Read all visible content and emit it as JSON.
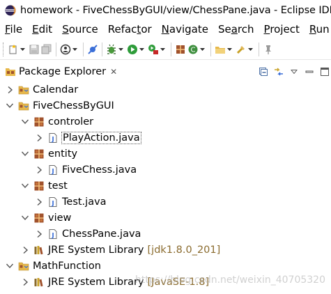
{
  "window": {
    "title": "homework - FiveChessByGUI/view/ChessPane.java - Eclipse IDE"
  },
  "menubar": {
    "items": [
      {
        "mnemonic": "F",
        "rest": "ile"
      },
      {
        "mnemonic": "E",
        "rest": "dit"
      },
      {
        "mnemonic": "S",
        "rest": "ource"
      },
      {
        "pre": "Refac",
        "mnemonic": "t",
        "rest": "or"
      },
      {
        "mnemonic": "N",
        "rest": "avigate"
      },
      {
        "pre": "Se",
        "mnemonic": "a",
        "rest": "rch"
      },
      {
        "mnemonic": "P",
        "rest": "roject"
      },
      {
        "mnemonic": "R",
        "rest": "un"
      }
    ]
  },
  "view": {
    "tab_label": "Package Explorer",
    "close_glyph": "✕"
  },
  "tree": [
    {
      "label": "Calendar",
      "decoration": "",
      "twisty": "collapsed",
      "icon": "project-icon"
    },
    {
      "label": "FiveChessByGUI",
      "decoration": "",
      "twisty": "expanded",
      "icon": "project-icon"
    },
    {
      "label": "controler",
      "decoration": "",
      "twisty": "expanded",
      "icon": "package-icon"
    },
    {
      "label": "PlayAction.java",
      "decoration": "",
      "twisty": "collapsed",
      "icon": "java-file-icon",
      "selected": true
    },
    {
      "label": "entity",
      "decoration": "",
      "twisty": "expanded",
      "icon": "package-icon"
    },
    {
      "label": "FiveChess.java",
      "decoration": "",
      "twisty": "collapsed",
      "icon": "java-file-icon"
    },
    {
      "label": "test",
      "decoration": "",
      "twisty": "expanded",
      "icon": "package-icon"
    },
    {
      "label": "Test.java",
      "decoration": "",
      "twisty": "collapsed",
      "icon": "java-file-icon"
    },
    {
      "label": "view",
      "decoration": "",
      "twisty": "expanded",
      "icon": "package-icon"
    },
    {
      "label": "ChessPane.java",
      "decoration": "",
      "twisty": "collapsed",
      "icon": "java-file-icon"
    },
    {
      "label": "JRE System Library",
      "decoration": "[jdk1.8.0_201]",
      "twisty": "collapsed",
      "icon": "library-icon"
    },
    {
      "label": "MathFunction",
      "decoration": "",
      "twisty": "expanded",
      "icon": "project-icon"
    },
    {
      "label": "JRE System Library",
      "decoration": "[JavaSE-1.8]",
      "twisty": "collapsed",
      "icon": "library-icon"
    }
  ],
  "watermark": {
    "text": "https://blog.csdn.net/weixin_40705320"
  },
  "colors": {
    "decoration": "#8a6b2e",
    "package_brown": "#a0522d",
    "eclipse_purple": "#2c2255"
  }
}
